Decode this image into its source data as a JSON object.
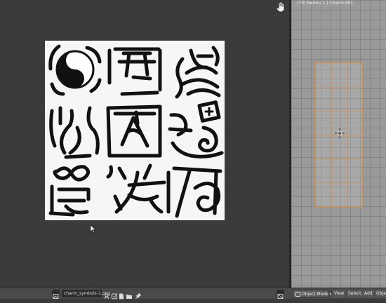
{
  "viewport": {
    "info_text": "(73) Reimu-1 | Charm.001"
  },
  "image_editor": {
    "image_name": "charm_symbols-1.png",
    "symbols": [
      "yin-yang",
      "torii",
      "wave",
      "flame",
      "triangle",
      "spiral-die",
      "infinity-box",
      "star-scratch",
      "house-coil"
    ]
  },
  "header": {
    "mode_label": "Object Mode",
    "menus": [
      "View",
      "Select",
      "Add",
      "Objec"
    ]
  },
  "colors": {
    "selection": "#e48a2a",
    "editor_bg": "#393939",
    "viewport_bg": "#9a9a9a",
    "header_bg": "#4a4a4a"
  }
}
